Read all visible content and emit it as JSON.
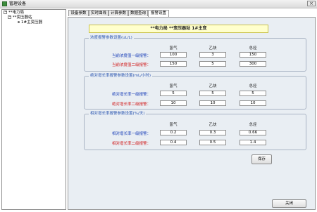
{
  "window": {
    "title": "管理设备"
  },
  "tree": {
    "root": "**电力局",
    "child": "**变压器站",
    "leaf": "1#主变压器"
  },
  "tabs": [
    "设备参数",
    "实时曲线",
    "计算参数",
    "数据查询",
    "报警设置"
  ],
  "active_tab": "报警设置",
  "banner": "**电力局  **变压器站  1#主变",
  "columns": [
    "氢气",
    "乙炔",
    "总烃"
  ],
  "groups": [
    {
      "title": "浓度报警参数设置(uL/L)",
      "rows": [
        {
          "label": "当前浓度值一级报警：",
          "values": [
            "100",
            "3",
            "150"
          ]
        },
        {
          "label": "当前浓度值二级报警：",
          "values": [
            "150",
            "5",
            "300"
          ]
        }
      ]
    },
    {
      "title": "绝对增长率报警参数设置(mL/小时)",
      "rows": [
        {
          "label": "绝对增长率一级报警：",
          "values": [
            "5",
            "5",
            "5"
          ]
        },
        {
          "label": "绝对增长率二级报警：",
          "values": [
            "10",
            "10",
            "10"
          ]
        }
      ]
    },
    {
      "title": "相对增长率报警参数设置(%/天)",
      "rows": [
        {
          "label": "相对增长率一级报警：",
          "values": [
            "0.2",
            "0.3",
            "0.66"
          ]
        },
        {
          "label": "相对增长率二级报警：",
          "values": [
            "0.4",
            "0.5",
            "1.4"
          ]
        }
      ]
    }
  ],
  "buttons": {
    "save": "保存",
    "close": "关闭"
  },
  "colors": {
    "group_title": "#2a55b0",
    "label_level1": "#1a3fb8",
    "label_level2": "#d11a1a",
    "banner_bg": "#ffffcc"
  }
}
